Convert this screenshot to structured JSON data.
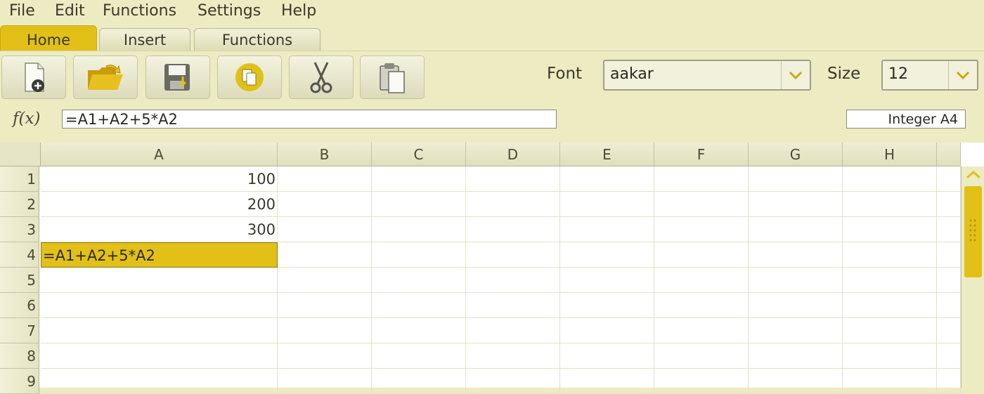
{
  "menu": [
    "File",
    "Edit",
    "Functions",
    "Settings",
    "Help"
  ],
  "tabs": [
    "Home",
    "Insert",
    "Functions"
  ],
  "toolbar": {
    "buttons": [
      "new-document-icon",
      "open-folder-icon",
      "save-icon",
      "copy-icon",
      "cut-icon",
      "paste-icon"
    ],
    "font_label": "Font",
    "font_value": "aakar",
    "size_label": "Size",
    "size_value": "12"
  },
  "formula_bar": {
    "label": "f(x)",
    "value": "=A1+A2+5*A2",
    "cell_info": "Integer A4"
  },
  "sheet": {
    "columns": [
      "A",
      "B",
      "C",
      "D",
      "E",
      "F",
      "G",
      "H"
    ],
    "rows": [
      "1",
      "2",
      "3",
      "4",
      "5",
      "6",
      "7",
      "8",
      "9"
    ],
    "cells": {
      "A1": "100",
      "A2": "200",
      "A3": "300",
      "A4": "=A1+A2+5*A2"
    },
    "selected_cell": "A4"
  },
  "colors": {
    "accent": "#e2c018",
    "background": "#ecebc2"
  }
}
